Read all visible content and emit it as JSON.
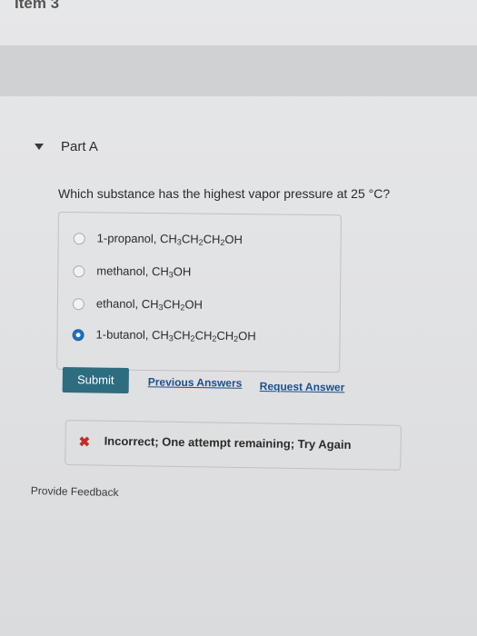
{
  "item": {
    "title": "Item 3"
  },
  "part": {
    "title": "Part A"
  },
  "question": {
    "text": "Which substance has the highest vapor pressure at 25 °C?"
  },
  "choices": [
    {
      "label": [
        "1-propanol, CH",
        "3",
        "CH",
        "2",
        "CH",
        "2",
        "OH"
      ],
      "selected": false
    },
    {
      "label": [
        "methanol, CH",
        "3",
        "OH"
      ],
      "selected": false
    },
    {
      "label": [
        "ethanol, CH",
        "3",
        "CH",
        "2",
        "OH"
      ],
      "selected": false
    },
    {
      "label": [
        "1-butanol, CH",
        "3",
        "CH",
        "2",
        "CH",
        "2",
        "CH",
        "2",
        "OH"
      ],
      "selected": true
    }
  ],
  "actions": {
    "submit_label": "Submit",
    "previous_answers_label": "Previous Answers",
    "request_answer_label": "Request Answer"
  },
  "feedback": {
    "icon": "x-icon",
    "icon_glyph": "✖",
    "status_color": "#c62a2a",
    "message": "Incorrect; One attempt remaining; Try Again"
  },
  "footer": {
    "provide_feedback_label": "Provide Feedback"
  },
  "colors": {
    "submit_bg": "#2e6c80",
    "link": "#1d4f8c",
    "radio_selected": "#1d6fc4"
  }
}
